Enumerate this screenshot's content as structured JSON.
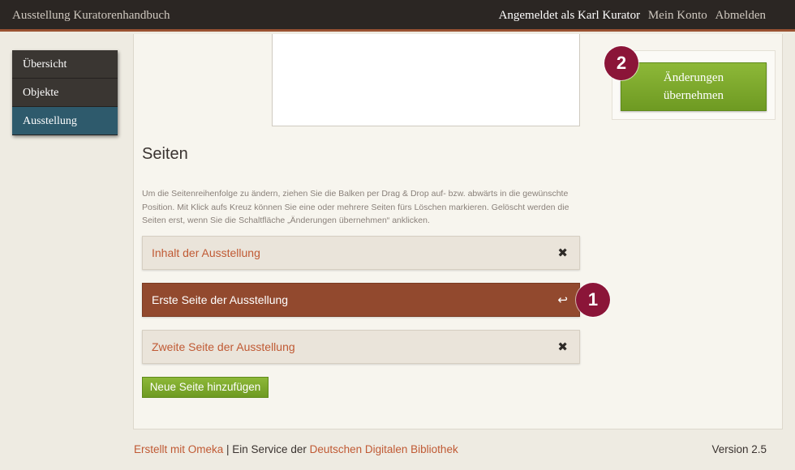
{
  "header": {
    "app_title": "Ausstellung Kuratorenhandbuch",
    "logged_in_text": "Angemeldet als Karl Kurator",
    "account_link": "Mein Konto",
    "logout_link": "Abmelden"
  },
  "sidebar": {
    "items": [
      {
        "label": "Übersicht"
      },
      {
        "label": "Objekte"
      },
      {
        "label": "Ausstellung",
        "active": true
      }
    ]
  },
  "save_button": {
    "label": "Änderungen\nübernehmen"
  },
  "callouts": {
    "one": "1",
    "two": "2"
  },
  "pages_section": {
    "title": "Seiten",
    "help_text": "Um die Seitenreihenfolge zu ändern, ziehen Sie die Balken per Drag & Drop auf- bzw. abwärts in die gewünschte Position. Mit Klick aufs Kreuz können Sie eine oder mehrere Seiten fürs Löschen markieren. Gelöscht werden die Seiten erst, wenn Sie die Schaltfläche „Änderungen übernehmen“ anklicken.",
    "pages": [
      {
        "label": "Inhalt der Ausstellung",
        "action_icon": "✖",
        "icon_name": "delete-x-icon"
      },
      {
        "label": "Erste Seite der Ausstellung",
        "action_icon": "↩",
        "icon_name": "undo-icon",
        "marked_for_deletion": true
      },
      {
        "label": "Zweite Seite der Ausstellung",
        "action_icon": "✖",
        "icon_name": "delete-x-icon"
      }
    ],
    "add_button": "Neue Seite hinzufügen"
  },
  "footer": {
    "created_with": "Erstellt mit Omeka",
    "separator": " | Ein Service der ",
    "ddb_link": "Deutschen Digitalen Bibliothek",
    "version": "Version 2.5"
  },
  "colors": {
    "accent_brown": "#92492e",
    "link_orange": "#c05a34",
    "active_nav": "#2e5a6c",
    "button_green": "#7ba82c",
    "callout": "#8b1538"
  }
}
